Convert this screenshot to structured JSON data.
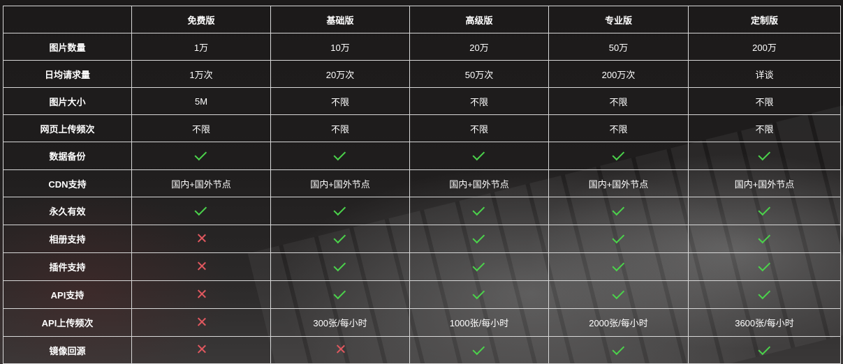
{
  "headers": [
    "",
    "免费版",
    "基础版",
    "高级版",
    "专业版",
    "定制版"
  ],
  "rows": [
    {
      "label": "图片数量",
      "cells": [
        {
          "type": "text",
          "value": "1万"
        },
        {
          "type": "text",
          "value": "10万"
        },
        {
          "type": "text",
          "value": "20万"
        },
        {
          "type": "text",
          "value": "50万"
        },
        {
          "type": "text",
          "value": "200万"
        }
      ]
    },
    {
      "label": "日均请求量",
      "cells": [
        {
          "type": "text",
          "value": "1万次"
        },
        {
          "type": "text",
          "value": "20万次"
        },
        {
          "type": "text",
          "value": "50万次"
        },
        {
          "type": "text",
          "value": "200万次"
        },
        {
          "type": "text",
          "value": "详谈"
        }
      ]
    },
    {
      "label": "图片大小",
      "cells": [
        {
          "type": "text",
          "value": "5M"
        },
        {
          "type": "text",
          "value": "不限"
        },
        {
          "type": "text",
          "value": "不限"
        },
        {
          "type": "text",
          "value": "不限"
        },
        {
          "type": "text",
          "value": "不限"
        }
      ]
    },
    {
      "label": "网页上传频次",
      "cells": [
        {
          "type": "text",
          "value": "不限"
        },
        {
          "type": "text",
          "value": "不限"
        },
        {
          "type": "text",
          "value": "不限"
        },
        {
          "type": "text",
          "value": "不限"
        },
        {
          "type": "text",
          "value": "不限"
        }
      ]
    },
    {
      "label": "数据备份",
      "cells": [
        {
          "type": "icon",
          "icon": "check-icon"
        },
        {
          "type": "icon",
          "icon": "check-icon"
        },
        {
          "type": "icon",
          "icon": "check-icon"
        },
        {
          "type": "icon",
          "icon": "check-icon"
        },
        {
          "type": "icon",
          "icon": "check-icon"
        }
      ]
    },
    {
      "label": "CDN支持",
      "cells": [
        {
          "type": "text",
          "value": "国内+国外节点"
        },
        {
          "type": "text",
          "value": "国内+国外节点"
        },
        {
          "type": "text",
          "value": "国内+国外节点"
        },
        {
          "type": "text",
          "value": "国内+国外节点"
        },
        {
          "type": "text",
          "value": "国内+国外节点"
        }
      ]
    },
    {
      "label": "永久有效",
      "cells": [
        {
          "type": "icon",
          "icon": "check-icon"
        },
        {
          "type": "icon",
          "icon": "check-icon"
        },
        {
          "type": "icon",
          "icon": "check-icon"
        },
        {
          "type": "icon",
          "icon": "check-icon"
        },
        {
          "type": "icon",
          "icon": "check-icon"
        }
      ]
    },
    {
      "label": "相册支持",
      "cells": [
        {
          "type": "icon",
          "icon": "cross-icon"
        },
        {
          "type": "icon",
          "icon": "check-icon"
        },
        {
          "type": "icon",
          "icon": "check-icon"
        },
        {
          "type": "icon",
          "icon": "check-icon"
        },
        {
          "type": "icon",
          "icon": "check-icon"
        }
      ]
    },
    {
      "label": "插件支持",
      "cells": [
        {
          "type": "icon",
          "icon": "cross-icon"
        },
        {
          "type": "icon",
          "icon": "check-icon"
        },
        {
          "type": "icon",
          "icon": "check-icon"
        },
        {
          "type": "icon",
          "icon": "check-icon"
        },
        {
          "type": "icon",
          "icon": "check-icon"
        }
      ]
    },
    {
      "label": "API支持",
      "cells": [
        {
          "type": "icon",
          "icon": "cross-icon"
        },
        {
          "type": "icon",
          "icon": "check-icon"
        },
        {
          "type": "icon",
          "icon": "check-icon"
        },
        {
          "type": "icon",
          "icon": "check-icon"
        },
        {
          "type": "icon",
          "icon": "check-icon"
        }
      ]
    },
    {
      "label": "API上传频次",
      "cells": [
        {
          "type": "icon",
          "icon": "cross-icon"
        },
        {
          "type": "text",
          "value": "300张/每小时"
        },
        {
          "type": "text",
          "value": "1000张/每小时"
        },
        {
          "type": "text",
          "value": "2000张/每小时"
        },
        {
          "type": "text",
          "value": "3600张/每小时"
        }
      ]
    },
    {
      "label": "镜像回源",
      "cells": [
        {
          "type": "icon",
          "icon": "cross-icon"
        },
        {
          "type": "icon",
          "icon": "cross-icon"
        },
        {
          "type": "icon",
          "icon": "check-icon"
        },
        {
          "type": "icon",
          "icon": "check-icon"
        },
        {
          "type": "icon",
          "icon": "check-icon"
        }
      ]
    }
  ],
  "colors": {
    "check": "#4bd34b",
    "cross": "#e0585f",
    "border": "#d8d8d8",
    "text": "#ffffff"
  }
}
